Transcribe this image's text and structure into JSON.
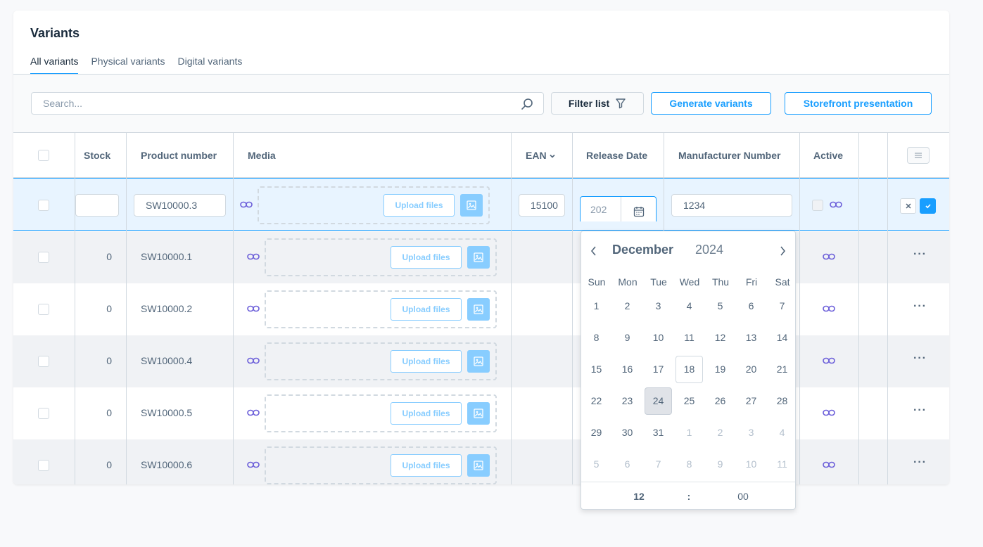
{
  "card": {
    "title": "Variants"
  },
  "tabs": [
    {
      "label": "All variants",
      "active": true
    },
    {
      "label": "Physical variants",
      "active": false
    },
    {
      "label": "Digital variants",
      "active": false
    }
  ],
  "toolbar": {
    "search_placeholder": "Search...",
    "filter_label": "Filter list",
    "generate_label": "Generate variants",
    "storefront_label": "Storefront presentation"
  },
  "columns": {
    "stock": "Stock",
    "product_number": "Product number",
    "media": "Media",
    "ean": "EAN",
    "release_date": "Release Date",
    "manufacturer_number": "Manufacturer Number",
    "active": "Active"
  },
  "edit_row": {
    "stock": "",
    "product_number": "SW10000.3",
    "ean": "15100",
    "release_date": "202",
    "manufacturer_number": "1234",
    "upload_label": "Upload files"
  },
  "rows": [
    {
      "stock": "0",
      "product_number": "SW10000.1",
      "upload_label": "Upload files",
      "actions": "···"
    },
    {
      "stock": "0",
      "product_number": "SW10000.2",
      "upload_label": "Upload files",
      "actions": "···"
    },
    {
      "stock": "0",
      "product_number": "SW10000.4",
      "upload_label": "Upload files",
      "actions": "···"
    },
    {
      "stock": "0",
      "product_number": "SW10000.5",
      "upload_label": "Upload files",
      "actions": "···"
    },
    {
      "stock": "0",
      "product_number": "SW10000.6",
      "upload_label": "Upload files",
      "actions": "···"
    }
  ],
  "calendar": {
    "month": "December",
    "year": "2024",
    "weekdays": [
      "Sun",
      "Mon",
      "Tue",
      "Wed",
      "Thu",
      "Fri",
      "Sat"
    ],
    "weeks": [
      [
        "1",
        "2",
        "3",
        "4",
        "5",
        "6",
        "7"
      ],
      [
        "8",
        "9",
        "10",
        "11",
        "12",
        "13",
        "14"
      ],
      [
        "15",
        "16",
        "17",
        "18",
        "19",
        "20",
        "21"
      ],
      [
        "22",
        "23",
        "24",
        "25",
        "26",
        "27",
        "28"
      ],
      [
        "29",
        "30",
        "31",
        "1",
        "2",
        "3",
        "4"
      ],
      [
        "5",
        "6",
        "7",
        "8",
        "9",
        "10",
        "11"
      ]
    ],
    "today": "18",
    "selected": "24",
    "hour": "12",
    "separator": ":",
    "minute": "00"
  },
  "colors": {
    "accent": "#189eff",
    "accent_light": "#88cdff",
    "link_icon": "#6b5ed9"
  },
  "icons": [
    "search-icon",
    "filter-icon",
    "link-icon",
    "image-icon",
    "calendar-icon",
    "chevron-left-icon",
    "chevron-right-icon",
    "chevron-down-icon",
    "close-icon",
    "check-icon",
    "list-icon"
  ]
}
